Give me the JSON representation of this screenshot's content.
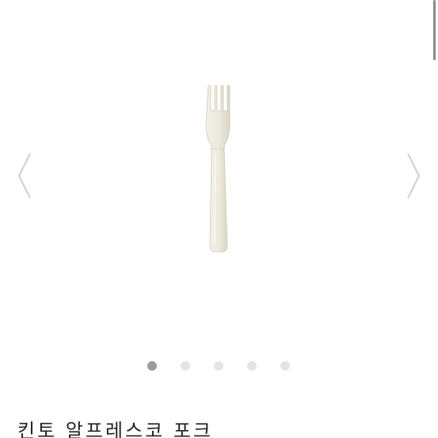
{
  "product": {
    "title": "킨토 알프레스코 포크",
    "image": {
      "subject": "fork-icon",
      "color": "#ece9dc"
    }
  },
  "carousel": {
    "prev_icon": "chevron-left-icon",
    "next_icon": "chevron-right-icon",
    "dot_count": 5,
    "active_index": 0
  },
  "colors": {
    "dot_active": "#9c9c9c",
    "dot_inactive": "#e4e4e4",
    "arrow": "#cfcfcf",
    "title": "#222222"
  }
}
